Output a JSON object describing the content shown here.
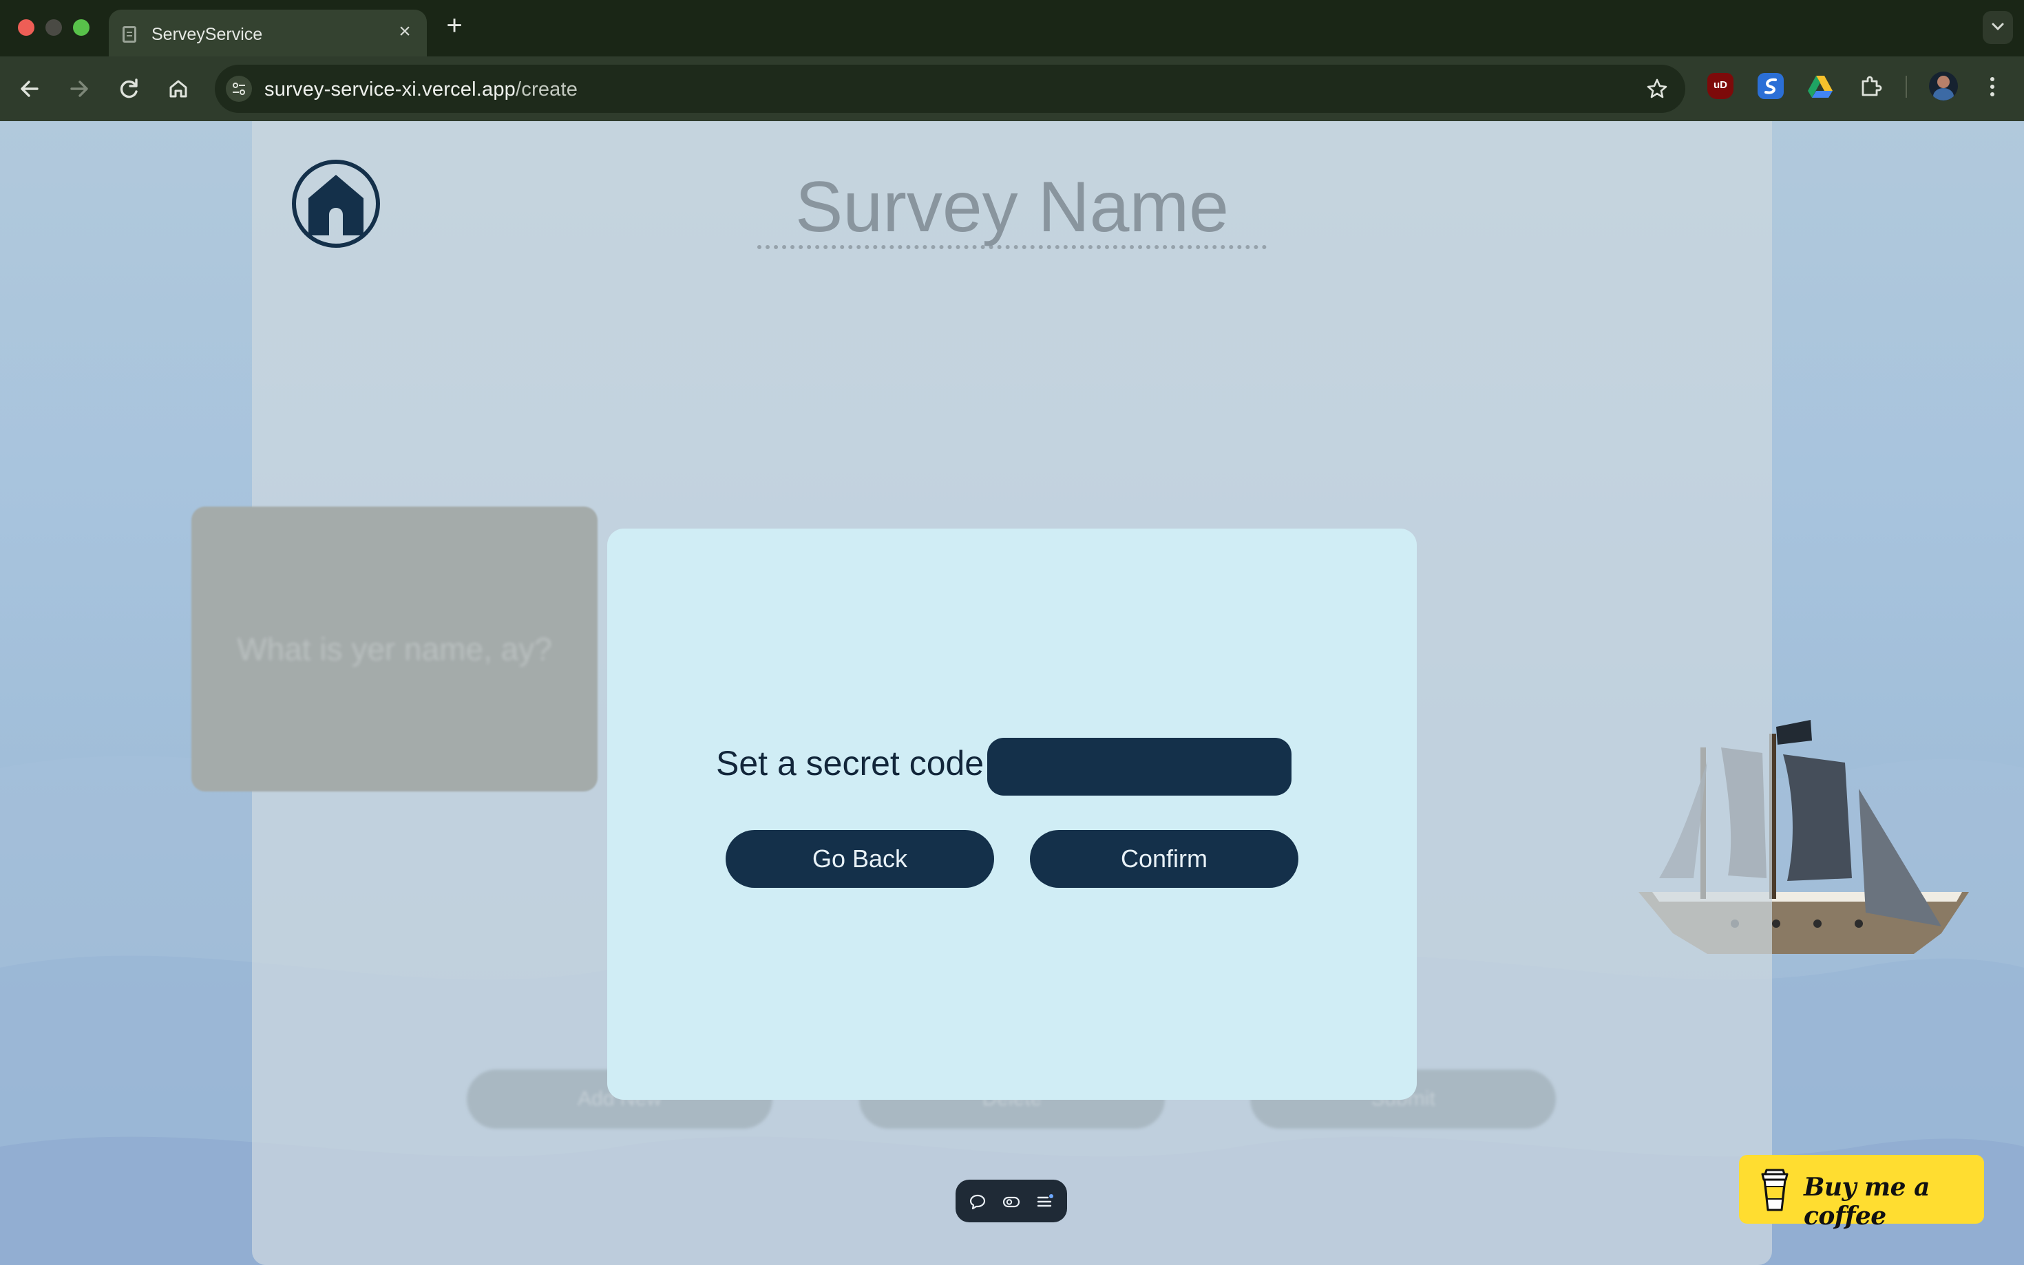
{
  "browser": {
    "tab_title": "ServeyService",
    "tab_close": "×",
    "new_tab": "+",
    "url_host": "survey-service-xi.vercel.app",
    "url_path": "/create",
    "extensions": [
      "ublock-icon",
      "sync-icon",
      "google-drive-icon",
      "puzzle-icon"
    ],
    "ublock_label": "uD"
  },
  "page": {
    "survey_title": "Survey Name",
    "background_card_text": "What is yer name, ay?",
    "ghost_buttons": [
      "Add New",
      "Delete",
      "Submit"
    ]
  },
  "modal": {
    "label": "Set a secret code",
    "input_value": "",
    "back_label": "Go Back",
    "confirm_label": "Confirm"
  },
  "coffee": {
    "label": "Buy me a coffee"
  },
  "colors": {
    "accent_navy": "#14304a",
    "modal_bg": "#d0edf5",
    "coffee_yellow": "#ffdd30"
  }
}
